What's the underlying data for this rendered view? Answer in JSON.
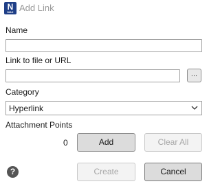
{
  "window": {
    "title": "Add Link",
    "app_icon_letter": "N",
    "app_icon_sub": "MAX"
  },
  "form": {
    "name_label": "Name",
    "name_value": "",
    "link_label": "Link to file or URL",
    "link_value": "",
    "browse_label": "...",
    "category_label": "Category",
    "category_value": "Hyperlink",
    "attachment_label": "Attachment Points",
    "attachment_count": "0"
  },
  "buttons": {
    "add": "Add",
    "clear_all": "Clear All",
    "create": "Create",
    "cancel": "Cancel"
  },
  "help": {
    "glyph": "?"
  },
  "icons": {
    "app": "app-logo-icon",
    "chevron": "chevron-down-icon",
    "help": "help-icon"
  },
  "colors": {
    "app_icon_bg": "#1f3f87",
    "disabled_text": "#a6a6a6"
  }
}
